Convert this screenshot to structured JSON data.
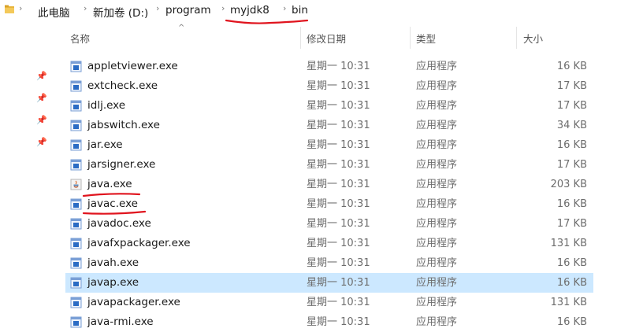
{
  "breadcrumb": {
    "items": [
      "此电脑",
      "新加卷 (D:)",
      "program",
      "myjdk8",
      "bin"
    ]
  },
  "columns": {
    "name": "名称",
    "date": "修改日期",
    "type": "类型",
    "size": "大小"
  },
  "files": [
    {
      "name": "appletviewer.exe",
      "date": "星期一 10:31",
      "type": "应用程序",
      "size": "16 KB",
      "icon": "exe-icon"
    },
    {
      "name": "extcheck.exe",
      "date": "星期一 10:31",
      "type": "应用程序",
      "size": "17 KB",
      "icon": "exe-icon"
    },
    {
      "name": "idlj.exe",
      "date": "星期一 10:31",
      "type": "应用程序",
      "size": "17 KB",
      "icon": "exe-icon"
    },
    {
      "name": "jabswitch.exe",
      "date": "星期一 10:31",
      "type": "应用程序",
      "size": "34 KB",
      "icon": "exe-icon"
    },
    {
      "name": "jar.exe",
      "date": "星期一 10:31",
      "type": "应用程序",
      "size": "16 KB",
      "icon": "exe-icon"
    },
    {
      "name": "jarsigner.exe",
      "date": "星期一 10:31",
      "type": "应用程序",
      "size": "17 KB",
      "icon": "exe-icon"
    },
    {
      "name": "java.exe",
      "date": "星期一 10:31",
      "type": "应用程序",
      "size": "203 KB",
      "icon": "java-icon"
    },
    {
      "name": "javac.exe",
      "date": "星期一 10:31",
      "type": "应用程序",
      "size": "16 KB",
      "icon": "exe-icon"
    },
    {
      "name": "javadoc.exe",
      "date": "星期一 10:31",
      "type": "应用程序",
      "size": "17 KB",
      "icon": "exe-icon"
    },
    {
      "name": "javafxpackager.exe",
      "date": "星期一 10:31",
      "type": "应用程序",
      "size": "131 KB",
      "icon": "exe-icon"
    },
    {
      "name": "javah.exe",
      "date": "星期一 10:31",
      "type": "应用程序",
      "size": "16 KB",
      "icon": "exe-icon"
    },
    {
      "name": "javap.exe",
      "date": "星期一 10:31",
      "type": "应用程序",
      "size": "16 KB",
      "icon": "exe-icon",
      "selected": true
    },
    {
      "name": "javapackager.exe",
      "date": "星期一 10:31",
      "type": "应用程序",
      "size": "131 KB",
      "icon": "exe-icon"
    },
    {
      "name": "java-rmi.exe",
      "date": "星期一 10:31",
      "type": "应用程序",
      "size": "16 KB",
      "icon": "exe-icon"
    }
  ],
  "colors": {
    "selection": "#cce8ff",
    "annotation": "#e0141e",
    "exe_icon": "#2b6cc4"
  }
}
